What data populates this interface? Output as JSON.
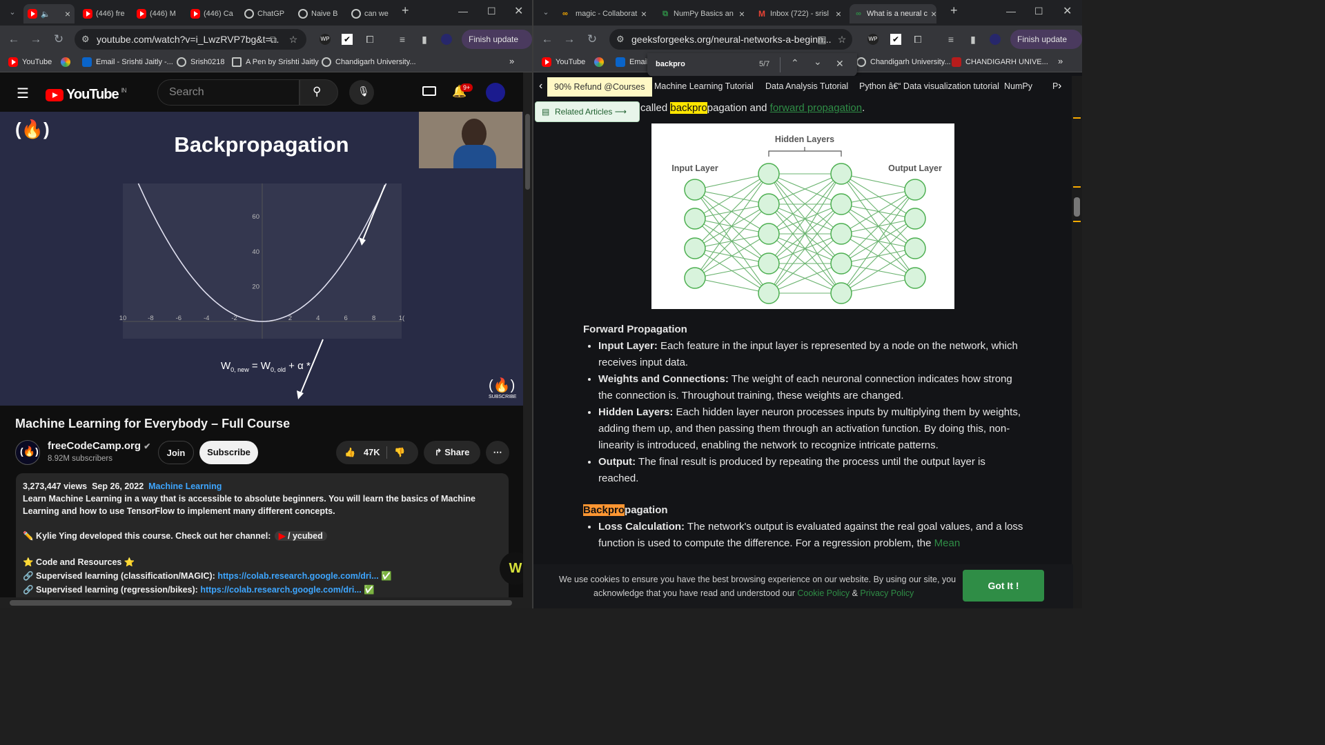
{
  "left_window": {
    "tabs": [
      {
        "label": "",
        "icon": "youtube-icon",
        "active": true
      },
      {
        "label": "(446) fre",
        "icon": "youtube-icon"
      },
      {
        "label": "(446) M",
        "icon": "youtube-icon"
      },
      {
        "label": "(446) Ca",
        "icon": "youtube-icon"
      },
      {
        "label": "ChatGP",
        "icon": "chatgpt-icon"
      },
      {
        "label": "Naive B",
        "icon": "chatgpt-icon"
      },
      {
        "label": "can we",
        "icon": "chatgpt-icon"
      }
    ],
    "url": "youtube.com/watch?v=i_LwzRVP7bg&t=...",
    "finish_update": "Finish update",
    "bookmarks": [
      "YouTube",
      "",
      "Email - Srishti Jaitly -...",
      "Srish0218",
      "A Pen by Srishti Jaitly",
      "Chandigarh University..."
    ]
  },
  "youtube": {
    "logo": "YouTube",
    "region": "IN",
    "search_placeholder": "Search",
    "notif_count": "9+",
    "slide": {
      "title": "Backpropagation",
      "subscribe": "SUBSCRIBE"
    },
    "chart_data": {
      "type": "line",
      "title": "",
      "x_ticks": [
        "10",
        "-8",
        "-6",
        "-4",
        "-2",
        "2",
        "4",
        "6",
        "8",
        "1("
      ],
      "y_ticks": [
        "20",
        "40",
        "60"
      ],
      "xlim": [
        -10,
        10
      ],
      "ylim": [
        0,
        70
      ],
      "series": [
        {
          "x": [
            -9,
            -8,
            -6,
            -4,
            -2,
            0,
            2,
            4,
            6,
            8,
            9
          ],
          "y": [
            81,
            64,
            36,
            16,
            4,
            0,
            4,
            16,
            36,
            64,
            81
          ]
        }
      ],
      "grid": false
    },
    "formula": {
      "w1": "W",
      "sub1": "0, new",
      "eq": "= W",
      "sub2": "0, old",
      "plus": "+ α *"
    },
    "video_title": "Machine Learning for Everybody – Full Course",
    "channel_name": "freeCodeCamp.org",
    "subscribers": "8.92M subscribers",
    "join": "Join",
    "subscribe": "Subscribe",
    "likes": "47K",
    "share": "Share",
    "description": {
      "views": "3,273,447 views",
      "date": "Sep 26, 2022",
      "tag": "Machine Learning",
      "line1": "Learn Machine Learning in a way that is accessible to absolute beginners. You will learn the basics of Machine Learning and how to use TensorFlow to implement many different concepts.",
      "line2": "✏️ Kylie Ying developed this course. Check out her channel:",
      "channel_chip": "/ ycubed",
      "line3": "⭐️ Code and Resources ⭐️",
      "line4_label": "🔗 Supervised learning (classification/MAGIC):",
      "line4_link": "https://colab.research.google.com/dri...",
      "line5_label": "🔗 Supervised learning (regression/bikes):",
      "line5_link": "https://colab.research.google.com/dri..."
    }
  },
  "right_window": {
    "tabs": [
      {
        "label": "magic - Collaborat",
        "icon": "colab-icon"
      },
      {
        "label": "NumPy Basics an",
        "icon": "gfg-icon"
      },
      {
        "label": "Inbox (722) - srisl",
        "icon": "gmail-icon"
      },
      {
        "label": "What is a neural c",
        "icon": "gfg-icon",
        "active": true
      }
    ],
    "url": "geeksforgeeks.org/neural-networks-a-beginn...",
    "finish_update": "Finish update",
    "bookmarks": [
      "YouTube",
      "",
      "Email",
      "Chandigarh University...",
      "CHANDIGARH UNIVE..."
    ],
    "find": {
      "query": "backpro",
      "count": "5/7"
    }
  },
  "gfg": {
    "nav_items": [
      "90% Refund @Courses",
      "Machine Learning Tutorial",
      "Data Analysis Tutorial",
      "Python â€“ Data visualization tutorial",
      "NumPy",
      "P"
    ],
    "related": "Related Articles",
    "intro_pre": "called",
    "intro_hl": "backpro",
    "intro_mid": "pagation and",
    "intro_link": "forward propagation",
    "intro_end": ".",
    "diagram": {
      "hidden": "Hidden Layers",
      "input": "Input Layer",
      "output": "Output Layer"
    },
    "fp_heading": "Forward Propagation",
    "fp_items": [
      {
        "b": "Input Layer:",
        "t": " Each feature in the input layer is represented by a node on the network, which receives input data."
      },
      {
        "b": "Weights and Connections:",
        "t": " The weight of each neuronal connection indicates how strong the connection is. Throughout training, these weights are changed."
      },
      {
        "b": "Hidden Layers:",
        "t": " Each hidden layer neuron processes inputs by multiplying them by weights, adding them up, and then passing them through an activation function. By doing this, non-linearity is introduced, enabling the network to recognize intricate patterns."
      },
      {
        "b": "Output:",
        "t": " The final result is produced by repeating the process until the output layer is reached."
      }
    ],
    "bp_heading_hl": "Backpro",
    "bp_heading_rest": "pagation",
    "bp_item_b": "Loss Calculation:",
    "bp_item_t": " The network's output is evaluated against the real goal values, and a loss function is used to compute the difference. For a regression problem, the",
    "bp_item_link": "Mean",
    "cookie_text1": "We use cookies to ensure you have the best browsing experience on our website. By using our site, you",
    "cookie_text2": "acknowledge that you have read and understood our",
    "cookie_policy": "Cookie Policy",
    "amp": "&",
    "privacy_policy": "Privacy Policy",
    "gotit": "Got It !"
  }
}
